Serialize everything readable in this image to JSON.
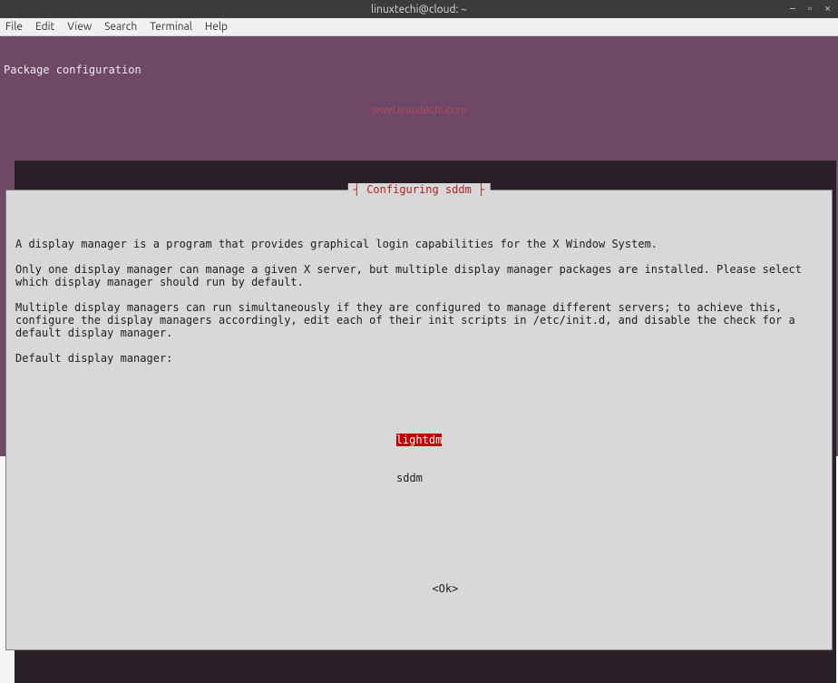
{
  "titlebar": {
    "title": "linuxtechi@cloud: ~"
  },
  "window_controls": {
    "minimize": "–",
    "maximize": "▫",
    "close": "×"
  },
  "menubar": {
    "file": "File",
    "edit": "Edit",
    "view": "View",
    "search": "Search",
    "terminal": "Terminal",
    "help": "Help"
  },
  "terminal": {
    "package_config_label": "Package configuration",
    "watermark": "www.linuxtechi.com"
  },
  "dialog": {
    "title": "Configuring sddm",
    "para1": "A display manager is a program that provides graphical login capabilities for the X Window System.",
    "para2": "Only one display manager can manage a given X server, but multiple display manager packages are installed. Please select which display manager should run by default.",
    "para3": "Multiple display managers can run simultaneously if they are configured to manage different servers; to achieve this, configure the display managers accordingly, edit each of their init scripts in /etc/init.d, and disable the check for a default display manager.",
    "prompt": "Default display manager:",
    "options": [
      "lightdm",
      "sddm"
    ],
    "ok": "<Ok>"
  }
}
